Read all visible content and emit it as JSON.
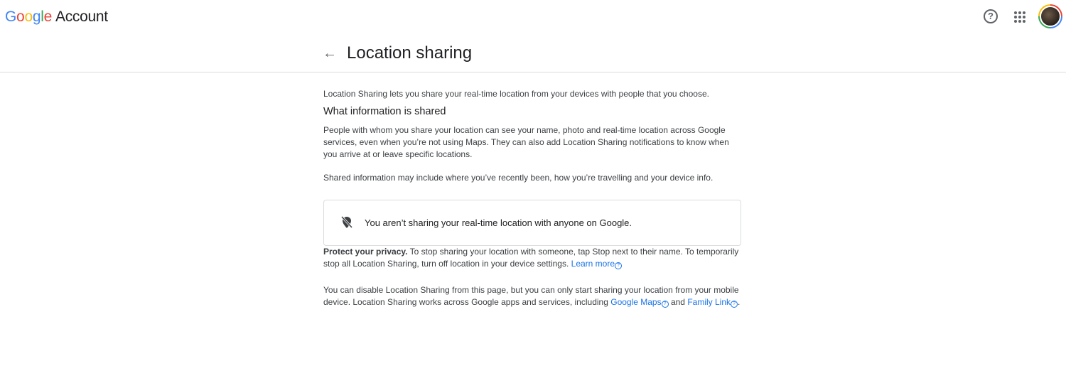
{
  "header": {
    "logo_parts": [
      "G",
      "o",
      "o",
      "g",
      "l",
      "e"
    ],
    "logo_suffix": "Account",
    "help": "?"
  },
  "page": {
    "title": "Location sharing"
  },
  "intro": "Location Sharing lets you share your real-time location from your devices with people that you choose.",
  "section_heading": "What information is shared",
  "para1": "People with whom you share your location can see your name, photo and real-time location across Google services, even when you’re not using Maps. They can also add Location Sharing notifications to know when you arrive at or leave specific locations.",
  "para2": "Shared information may include where you’ve recently been, how you’re travelling and your device info.",
  "status_card": {
    "icon": "location-off-icon",
    "text": "You aren’t sharing your real-time location with anyone on Google."
  },
  "privacy": {
    "bold": "Protect your privacy.",
    "text": " To stop sharing your location with someone, tap Stop next to their name. To temporarily stop all Location Sharing, turn off location in your device settings. ",
    "link": "Learn more"
  },
  "footer": {
    "text1": "You can disable Location Sharing from this page, but you can only start sharing your location from your mobile device. Location Sharing works across Google apps and services, including ",
    "link1": "Google Maps",
    "text2": " and ",
    "link2": "Family Link",
    "text3": "."
  }
}
